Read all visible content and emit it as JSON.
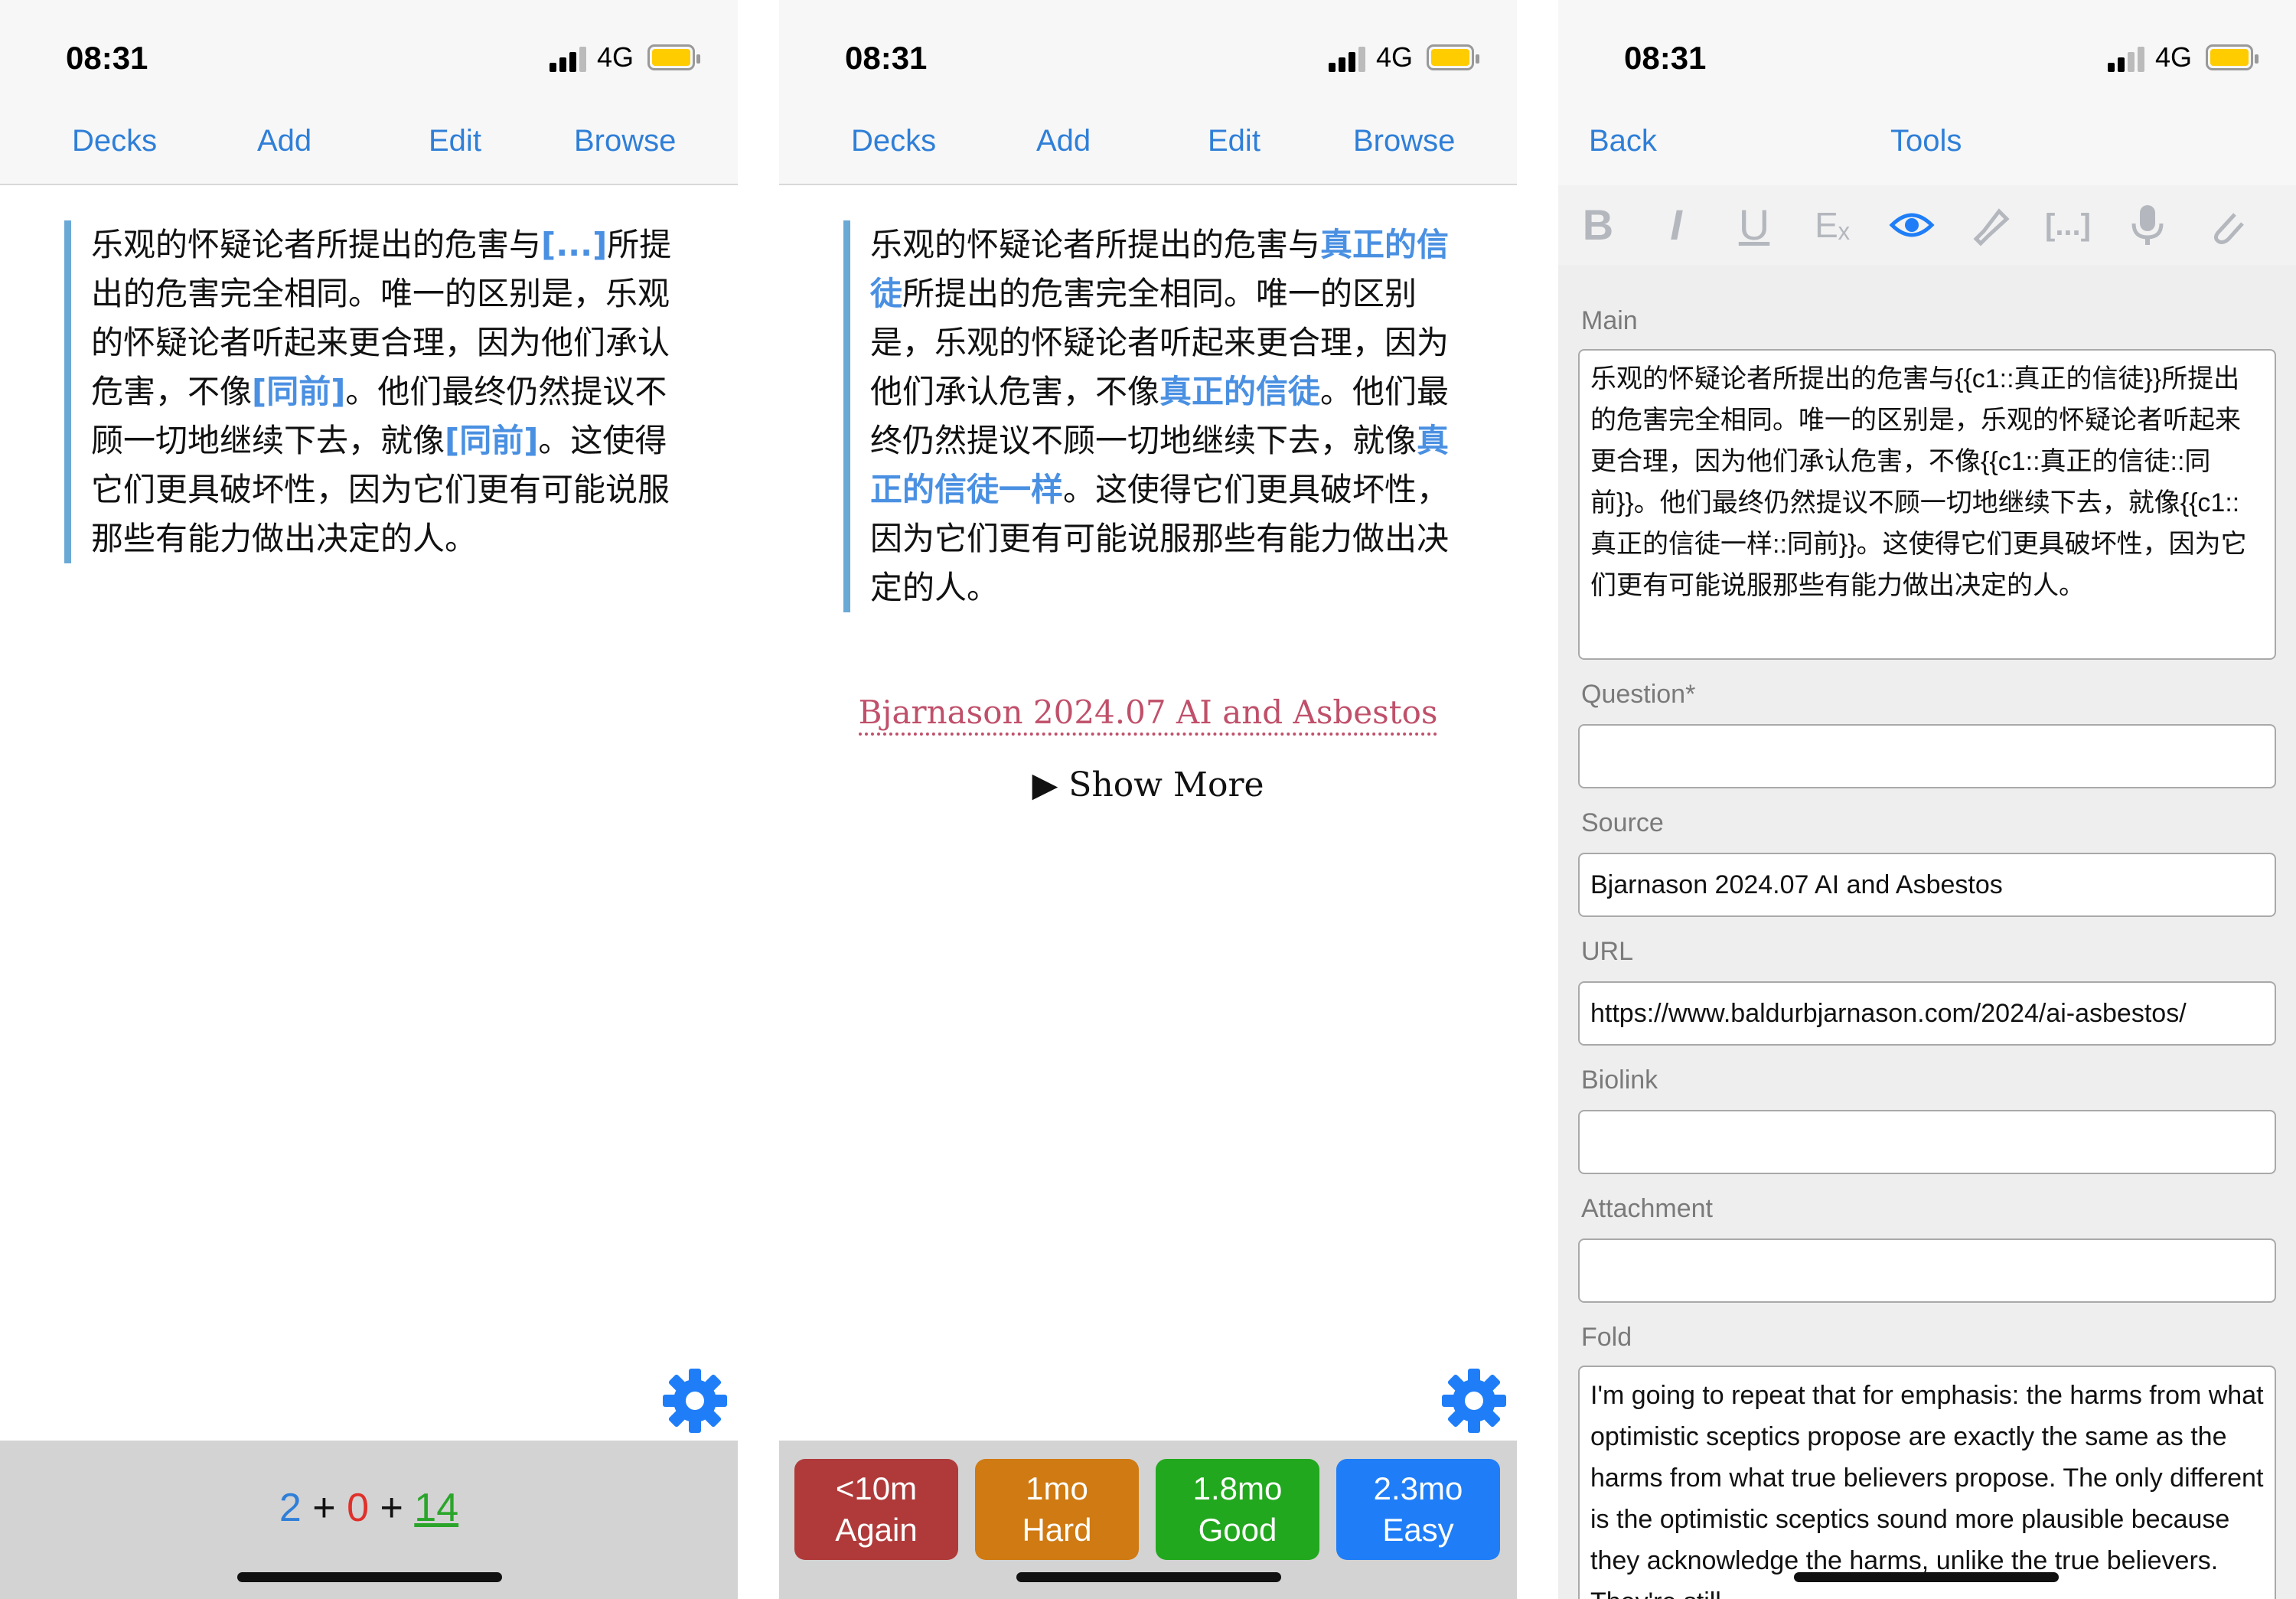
{
  "status": {
    "time": "08:31",
    "network": "4G"
  },
  "reviewer": {
    "nav": {
      "decks": "Decks",
      "add": "Add",
      "edit": "Edit",
      "browse": "Browse"
    },
    "question": {
      "p1": "乐观的怀疑论者所提出的危害与",
      "cloze1": "[...]",
      "p2": "所提出的危害完全相同。唯一的区别是，乐观的怀疑论者听起来更合理，因为他们承认危害，不像",
      "cloze2": "[同前]",
      "p3": "。他们最终仍然提议不顾一切地继续下去，就像",
      "cloze3": "[同前]",
      "p4": "。这使得它们更具破坏性，因为它们更有可能说服那些有能力做出决定的人。"
    },
    "counts": {
      "new": "2",
      "plus1": "+",
      "learn": "0",
      "plus2": "+",
      "due": "14"
    },
    "answer": {
      "p1": "乐观的怀疑论者所提出的危害与",
      "cloze1": "真正的信徒",
      "p2": "所提出的危害完全相同。唯一的区别是，乐观的怀疑论者听起来更合理，因为他们承认危害，不像",
      "cloze2": "真正的信徒",
      "p3": "。他们最终仍然提议不顾一切地继续下去，就像",
      "cloze3": "真正的信徒一样",
      "p4": "。这使得它们更具破坏性，因为它们更有可能说服那些有能力做出决定的人。",
      "source": "Bjarnason 2024.07 AI and Asbestos",
      "show_more": "Show More"
    },
    "buttons": [
      {
        "interval": "<10m",
        "label": "Again"
      },
      {
        "interval": "1mo",
        "label": "Hard"
      },
      {
        "interval": "1.8mo",
        "label": "Good"
      },
      {
        "interval": "2.3mo",
        "label": "Easy"
      }
    ]
  },
  "editor": {
    "nav": {
      "back": "Back",
      "tools": "Tools"
    },
    "toolbar": {
      "bold": "B",
      "italic": "I",
      "underline": "U",
      "clear": "Eₓ",
      "cloze": "[...]"
    },
    "fields": {
      "main_label": "Main",
      "main_value": "乐观的怀疑论者所提出的危害与{{c1::真正的信徒}}所提出的危害完全相同。唯一的区别是，乐观的怀疑论者听起来更合理，因为他们承认危害，不像{{c1::真正的信徒::同前}}。他们最终仍然提议不顾一切地继续下去，就像{{c1::真正的信徒一样::同前}}。这使得它们更具破坏性，因为它们更有可能说服那些有能力做出决定的人。",
      "question_label": "Question*",
      "question_value": "",
      "source_label": "Source",
      "source_value": "Bjarnason 2024.07 AI and Asbestos",
      "url_label": "URL",
      "url_value": "https://www.baldurbjarnason.com/2024/ai-asbestos/",
      "biolink_label": "Biolink",
      "biolink_value": "",
      "attachment_label": "Attachment",
      "attachment_value": "",
      "fold_label": "Fold",
      "fold_value": "I'm going to repeat that for emphasis: the harms from what optimistic sceptics propose are exactly the same as the harms from what true believers propose. The only different is the optimistic sceptics sound more plausible because they acknowledge the harms, unlike the true believers. They're still"
    }
  },
  "colors": {
    "accent": "#2f7fd8",
    "cloze": "#4a90e2",
    "card_border": "#6aa9d6",
    "source": "#c0506a",
    "again": "#b03a3a",
    "hard": "#cf7a12",
    "good": "#22a81e",
    "easy": "#1f7ef7"
  }
}
